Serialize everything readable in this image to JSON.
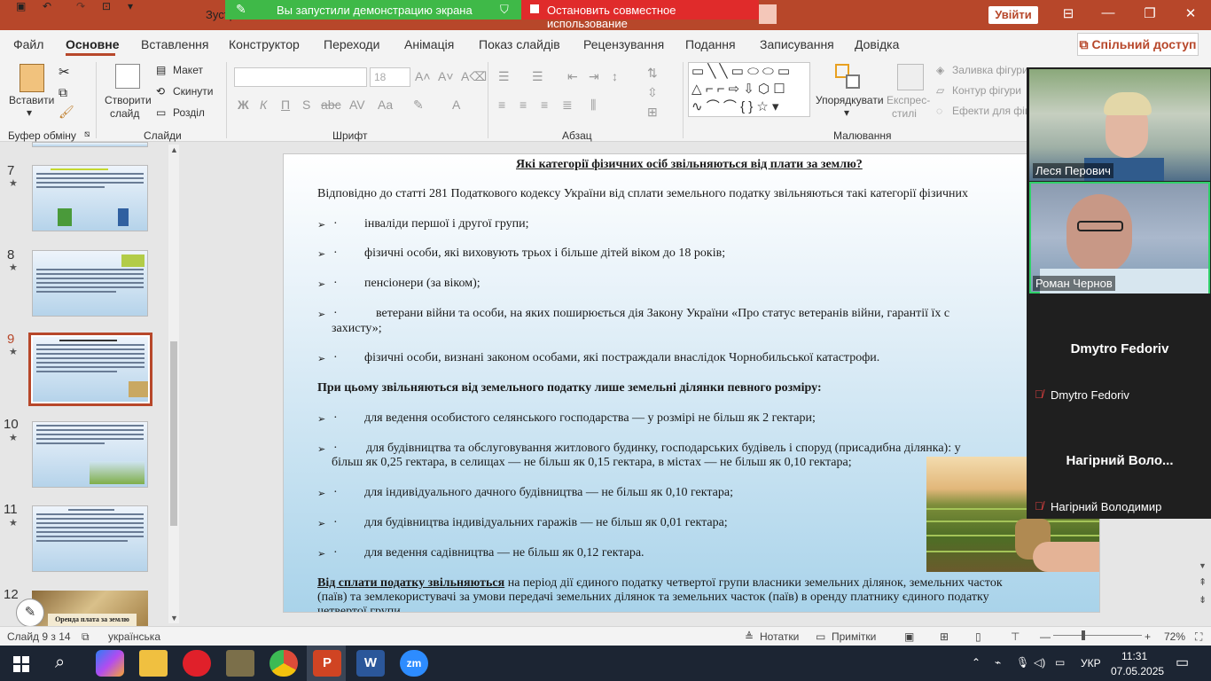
{
  "window": {
    "doc_title": "Зустріч Ч",
    "login_label": "Увійти"
  },
  "share": {
    "notice": "Вы запустили демонстрацию экрана",
    "stop_label": "Остановить совместное использование"
  },
  "menu": {
    "tabs": [
      "Файл",
      "Основне",
      "Вставлення",
      "Конструктор",
      "Переходи",
      "Анімація",
      "Показ слайдів",
      "Рецензування",
      "Подання",
      "Записування",
      "Довідка"
    ],
    "share_label": "Спільний доступ"
  },
  "ribbon": {
    "clipboard": {
      "paste": "Вставити",
      "group": "Буфер обміну"
    },
    "slides": {
      "new1": "Створити",
      "new2": "слайд",
      "layout": "Макет",
      "reset": "Скинути",
      "section": "Розділ",
      "group": "Слайди"
    },
    "font": {
      "size": "18",
      "group": "Шрифт"
    },
    "paragraph": {
      "group": "Абзац"
    },
    "drawing": {
      "arrange": "Упорядкувати",
      "express1": "Експрес-",
      "express2": "стилі",
      "fill": "Заливка фігури",
      "outline": "Контур фігури",
      "effects": "Ефекти для фігу",
      "group": "Малювання"
    }
  },
  "thumbnails": [
    {
      "num": "7",
      "star": "★"
    },
    {
      "num": "8",
      "star": "★"
    },
    {
      "num": "9",
      "star": "★"
    },
    {
      "num": "10",
      "star": "★"
    },
    {
      "num": "11",
      "star": "★"
    },
    {
      "num": "12",
      "star": ""
    }
  ],
  "thumb12_caption": "Оренда плата за землю",
  "slide": {
    "title": "Які категорії фізичних осіб звільняються від плати за землю?",
    "intro": "Відповідно до статті 281 Податкового кодексу України від сплати земельного податку звільняються такі категорії фізичних",
    "bullets1": [
      "інваліди першої і другої групи;",
      "фізичні особи, які виховують трьох і більше дітей віком до 18 років;",
      "пенсіонери (за віком);",
      "ветерани війни та особи, на яких поширюється дія Закону України «Про статус ветеранів війни, гарантії їх с",
      "фізичні особи, визнані законом особами, які постраждали внаслідок Чорнобильської катастрофи."
    ],
    "bullet1_4_cont": "захисту»;",
    "subhead": "При цьому звільняються від земельного податку лише земельні ділянки певного розміру:",
    "bullets2": [
      "для ведення особистого селянського господарства — у розмірі не більш як 2 гектари;",
      "для будівництва та обслуговування житлового будинку, господарських будівель і споруд (присадибна ділянка): у",
      "для індивідуального дачного будівництва — не більш як 0,10 гектара;",
      "для будівництва індивідуальних гаражів — не більш як 0,01 гектара;",
      "для ведення садівництва — не більш як 0,12 гектара."
    ],
    "bullet2_2_cont": "більш як 0,25 гектара, в селищах — не більш як 0,15 гектара, в містах — не більш як 0,10 гектара;",
    "bullet_dot": "·",
    "bullet_arrow": "➢",
    "footer_bold": "Від сплати податку звільняються",
    "footer_rest": " на період дії єдиного податку четвертої групи власники земельних ділянок, земельних часток",
    "footer_line2": "(паїв) та землекористувачі за умови передачі земельних ділянок та земельних часток (паїв) в оренду платнику єдиного податку",
    "footer_line3": "четвертої групи."
  },
  "participants": [
    {
      "name": "Леся Перович"
    },
    {
      "name": "Роман Чернов"
    },
    {
      "name": "Dmytro Fedoriv",
      "label": "Dmytro Fedoriv"
    },
    {
      "name": "Нагірний  Воло...",
      "label": "Нагірний Володимир"
    }
  ],
  "status": {
    "slide": "Слайд 9 з 14",
    "lang": "українська",
    "notes": "Нотатки",
    "comments": "Примітки",
    "zoom": "72%"
  },
  "tray": {
    "lang": "УКР",
    "time": "11:31",
    "date": "07.05.2025"
  }
}
